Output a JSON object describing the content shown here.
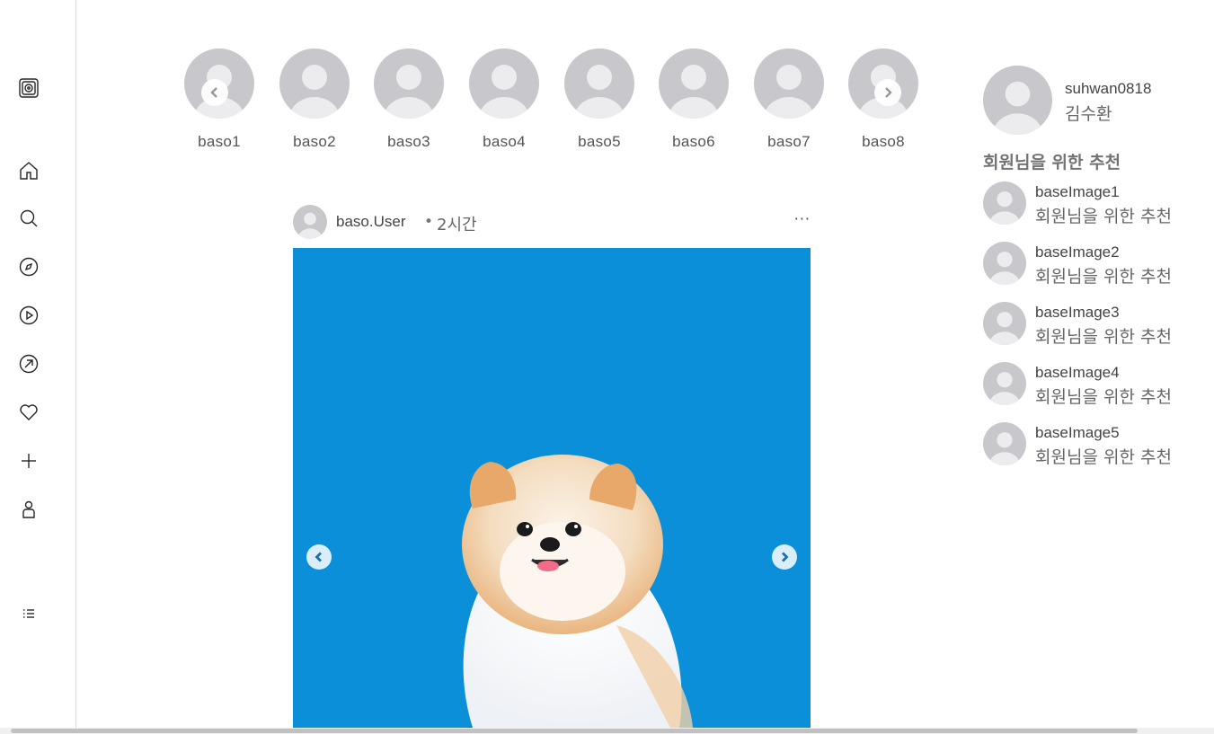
{
  "nav": {
    "items": [
      {
        "icon": "logo-icon"
      },
      {
        "icon": "home-icon"
      },
      {
        "icon": "search-icon"
      },
      {
        "icon": "explore-icon"
      },
      {
        "icon": "reels-icon"
      },
      {
        "icon": "messages-icon"
      },
      {
        "icon": "heart-icon"
      },
      {
        "icon": "plus-icon"
      },
      {
        "icon": "profile-icon"
      },
      {
        "icon": "menu-icon"
      }
    ]
  },
  "stories": [
    {
      "name": "baso1"
    },
    {
      "name": "baso2"
    },
    {
      "name": "baso3"
    },
    {
      "name": "baso4"
    },
    {
      "name": "baso5"
    },
    {
      "name": "baso6"
    },
    {
      "name": "baso7"
    },
    {
      "name": "baso8"
    }
  ],
  "post": {
    "user": "baso.User",
    "dot": "•",
    "time": "2시간",
    "more": "···"
  },
  "profile": {
    "username": "suhwan0818",
    "name": "김수환"
  },
  "recommend": {
    "title": "회원님을 위한 추천",
    "items": [
      {
        "user": "baseImage1",
        "subtitle": "회원님을 위한 추천"
      },
      {
        "user": "baseImage2",
        "subtitle": "회원님을 위한 추천"
      },
      {
        "user": "baseImage3",
        "subtitle": "회원님을 위한 추천"
      },
      {
        "user": "baseImage4",
        "subtitle": "회원님을 위한 추천"
      },
      {
        "user": "baseImage5",
        "subtitle": "회원님을 위한 추천"
      }
    ]
  },
  "colors": {
    "post_background": "#0a8fd8",
    "avatar_bg": "#c7c7cc",
    "avatar_fg": "#ececef"
  }
}
